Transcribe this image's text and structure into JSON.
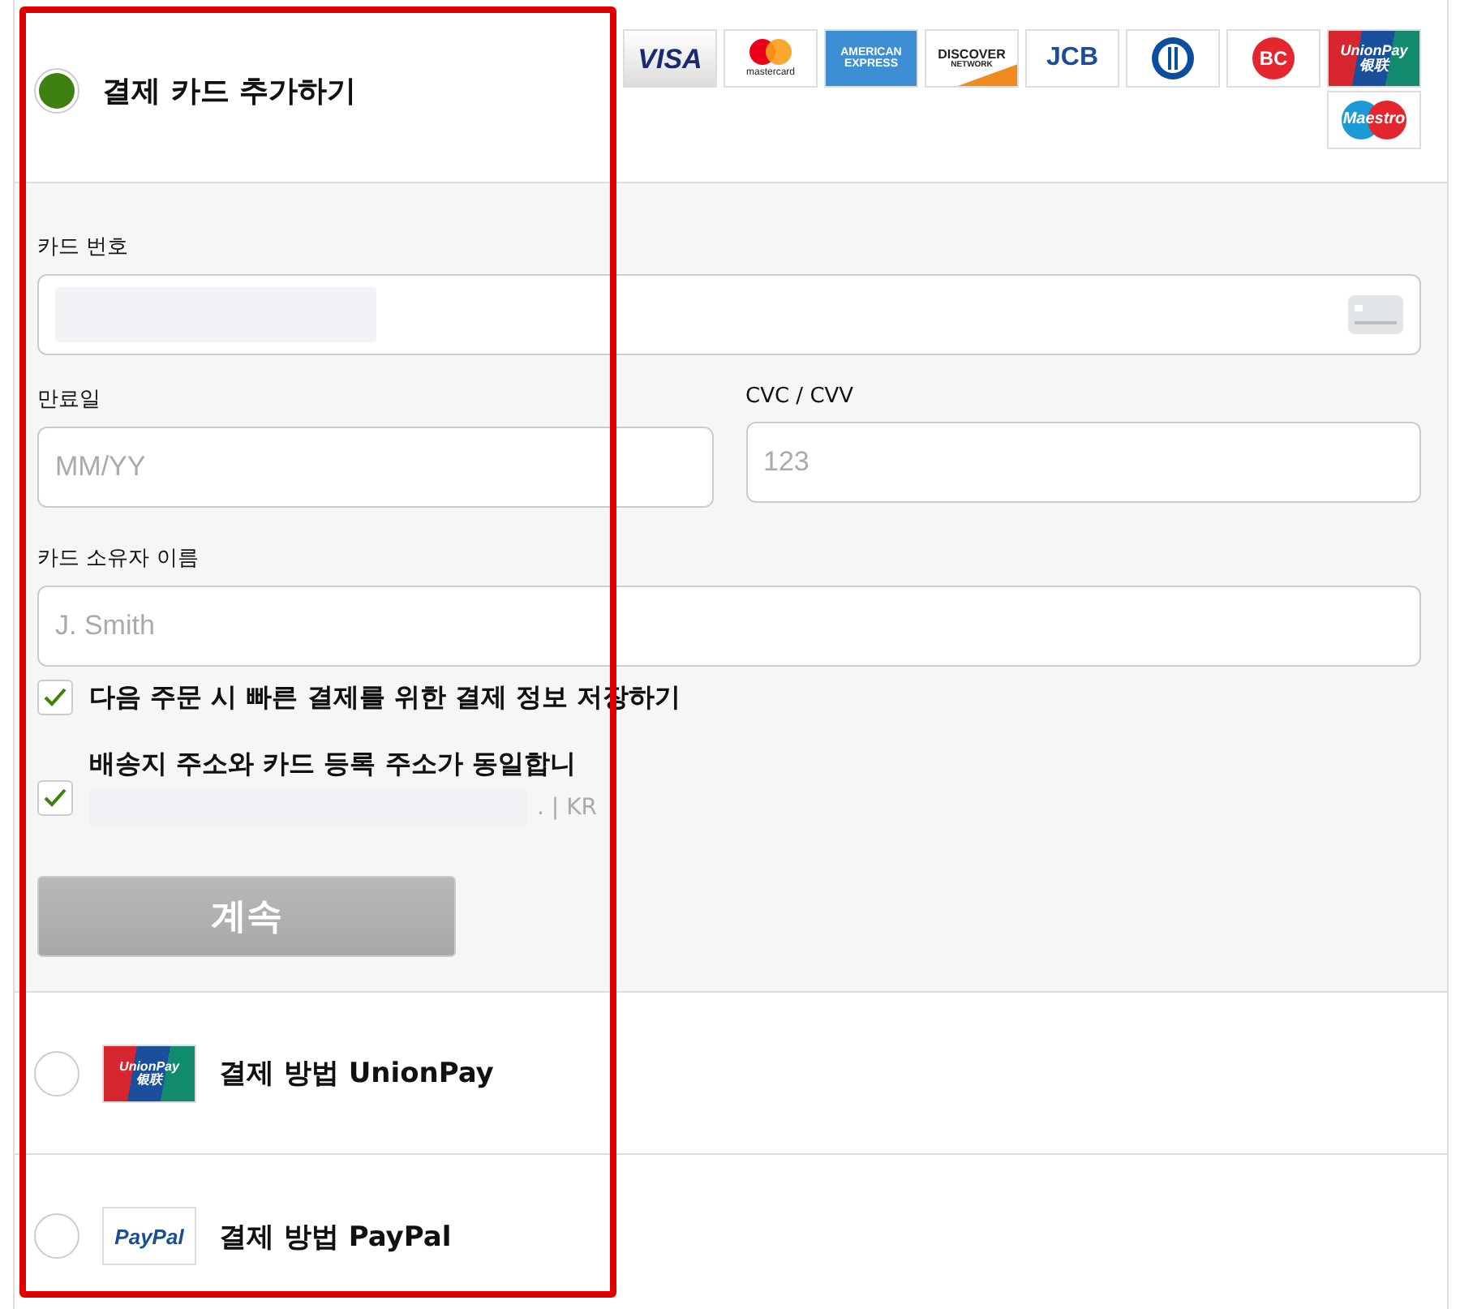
{
  "card_brands": [
    {
      "kind": "visa",
      "lines": [
        "VISA"
      ]
    },
    {
      "kind": "mastercard",
      "lines": [
        "mastercard"
      ]
    },
    {
      "kind": "amex",
      "lines": [
        "AMERICAN",
        "EXPRESS"
      ]
    },
    {
      "kind": "discover",
      "lines": [
        "DISCOVER",
        "NETWORK"
      ]
    },
    {
      "kind": "jcb",
      "lines": [
        "JCB"
      ]
    },
    {
      "kind": "diners"
    },
    {
      "kind": "bc",
      "lines": [
        "BC"
      ]
    },
    {
      "kind": "unionpay",
      "lines": [
        "UnionPay",
        "银联"
      ]
    },
    {
      "kind": "maestro",
      "lines": [
        "Maestro"
      ]
    }
  ],
  "card_option": {
    "title": "결제 카드 추가하기",
    "selected": true
  },
  "form": {
    "card_number": {
      "label": "카드 번호"
    },
    "expiry": {
      "label": "만료일",
      "placeholder": "MM/YY"
    },
    "cvc": {
      "label": "CVC / CVV",
      "placeholder": "123"
    },
    "holder": {
      "label": "카드 소유자 이름",
      "placeholder": "J. Smith"
    },
    "checkboxes": [
      {
        "label": "다음 주문 시 빠른 결제를 위한 결제 정보 저장하기",
        "checked": true
      },
      {
        "label": "배송지 주소와 카드 등록 주소가 동일합니",
        "checked": true,
        "address": ". | KR"
      }
    ],
    "continue_button": {
      "label": "계속",
      "disabled": true
    }
  },
  "other_methods": [
    {
      "kind": "unionpay",
      "title": "결제 방법 UnionPay",
      "selected": false,
      "logo_lines": [
        "UnionPay",
        "银联"
      ]
    },
    {
      "kind": "paypal",
      "title": "결제 방법 PayPal",
      "selected": false,
      "logo_lines": [
        "PayPal"
      ]
    }
  ]
}
